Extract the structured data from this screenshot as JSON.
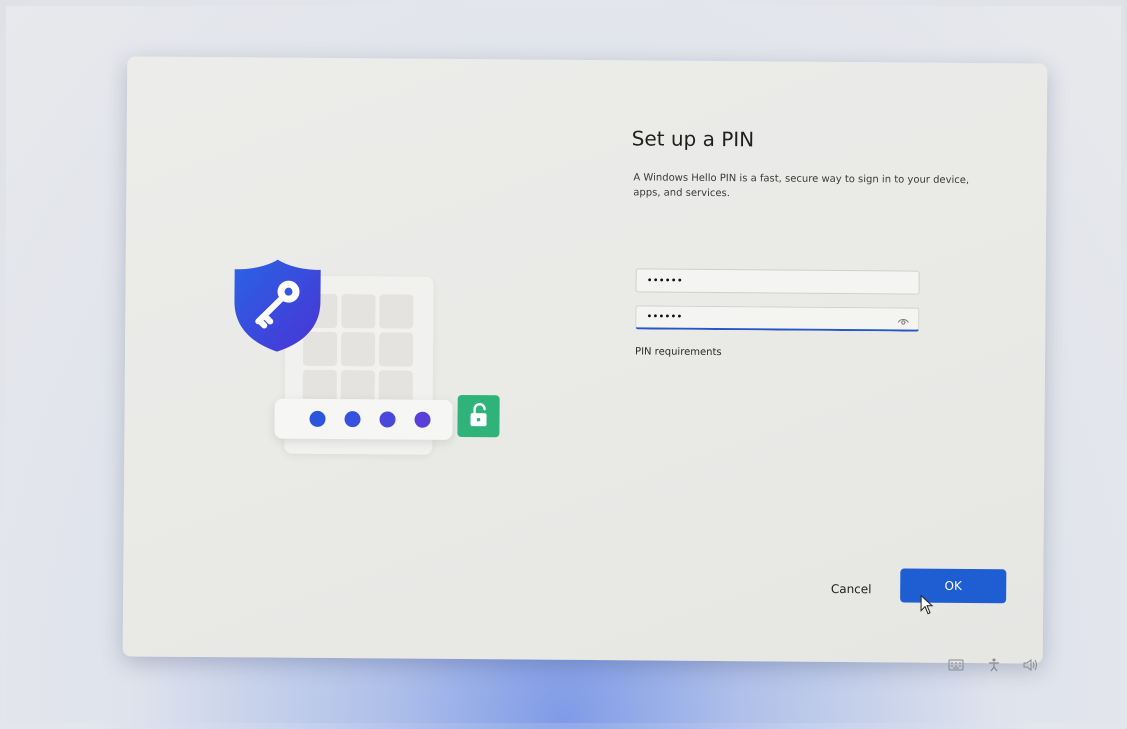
{
  "dialog": {
    "title": "Set up a PIN",
    "description": "A Windows Hello PIN is a fast, secure way to sign in to your device, apps, and services.",
    "new_pin_value": "••••••",
    "confirm_pin_value": "••••••",
    "pin_requirements_label": "PIN requirements",
    "cancel_label": "Cancel",
    "ok_label": "OK"
  },
  "colors": {
    "accent": "#1f5ed2",
    "shield": "#3b4fe0",
    "lock_tile": "#2fb37a"
  },
  "icons": {
    "illustration": [
      "shield-key-icon",
      "keypad-icon",
      "pin-dots-icon",
      "unlock-icon"
    ],
    "field": "eye-reveal-icon",
    "tray": [
      "keyboard-icon",
      "accessibility-icon",
      "volume-icon"
    ]
  }
}
